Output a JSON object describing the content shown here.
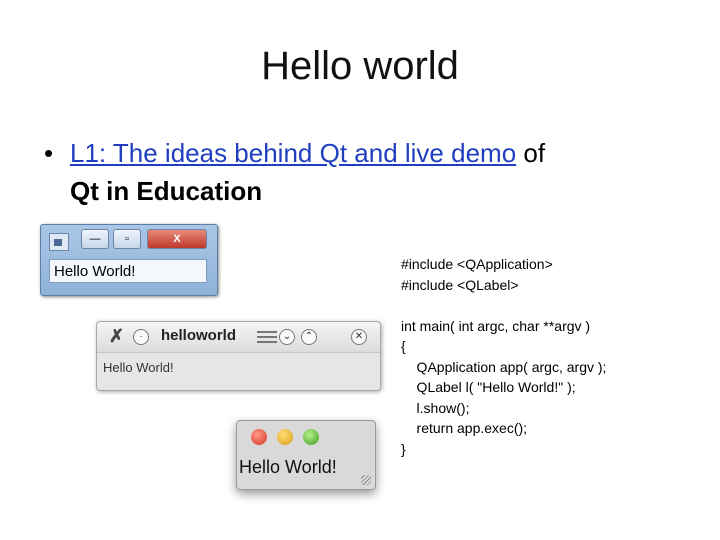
{
  "slide": {
    "title": "Hello world",
    "bullet": {
      "link_text": "L1: The ideas behind Qt and live demo",
      "after_link": " of",
      "second_line": "Qt in Education"
    }
  },
  "windows_window": {
    "close_glyph": "X",
    "min_glyph": "—",
    "max_glyph": "▫",
    "label": "Hello World!"
  },
  "kde_window": {
    "title": "helloworld",
    "label": "Hello World!"
  },
  "mac_window": {
    "label": "Hello World!"
  },
  "code": {
    "lines": [
      "#include <QApplication>",
      "#include <QLabel>",
      "",
      "int main( int argc, char **argv )",
      "{",
      "    QApplication app( argc, argv );",
      "    QLabel l( \"Hello World!\" );",
      "    l.show();",
      "    return app.exec();",
      "}"
    ]
  }
}
